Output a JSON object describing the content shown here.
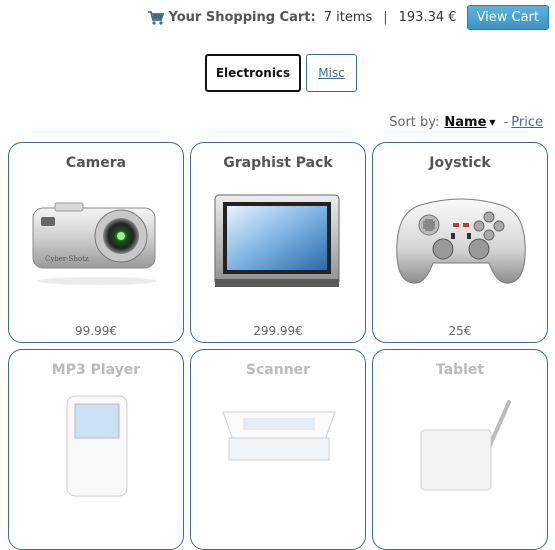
{
  "cart": {
    "title": "Your Shopping Cart:",
    "items": "7 items",
    "separator": "|",
    "total": "193.34 €",
    "button_label": "View Cart",
    "icon": "cart-icon"
  },
  "tabs": [
    {
      "label": "Electronics",
      "active": true
    },
    {
      "label": "Misc",
      "active": false
    }
  ],
  "sort": {
    "label": "Sort by:",
    "active": "Name",
    "dash": "-",
    "other": "Price"
  },
  "products": [
    {
      "name": "Camera",
      "price": "99.99€",
      "icon": "camera-icon"
    },
    {
      "name": "Graphist Pack",
      "price": "299.99€",
      "icon": "monitor-icon"
    },
    {
      "name": "Joystick",
      "price": "25€",
      "icon": "gamepad-icon"
    },
    {
      "name": "MP3 Player",
      "price": "",
      "icon": "mp3-player-icon"
    },
    {
      "name": "Scanner",
      "price": "",
      "icon": "scanner-icon"
    },
    {
      "name": "Tablet",
      "price": "",
      "icon": "tablet-icon"
    }
  ],
  "colors": {
    "accent": "#3f6f86",
    "button": "#3a93c4"
  }
}
